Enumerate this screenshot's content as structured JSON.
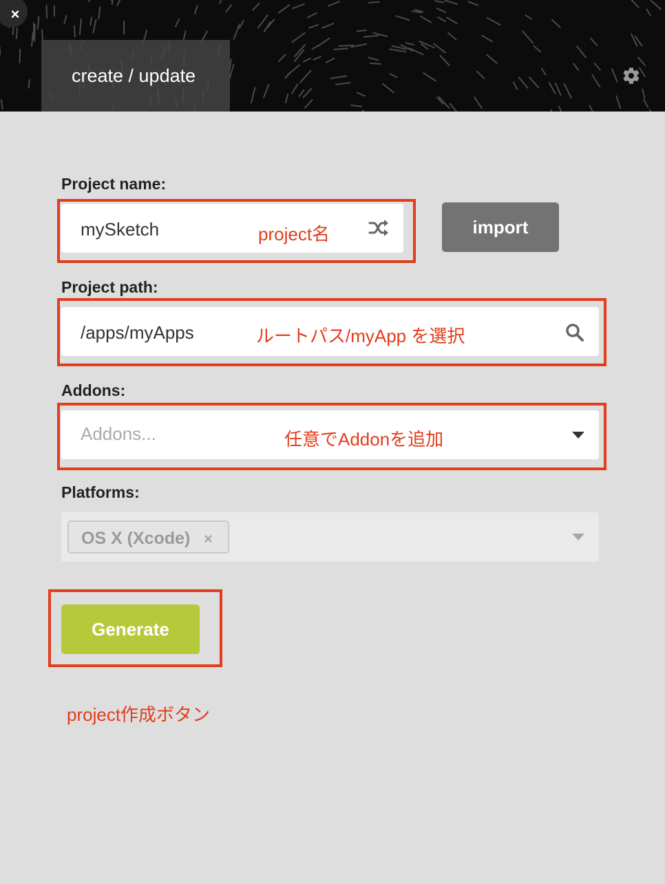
{
  "header": {
    "tab_label": "create / update",
    "close_icon": "×",
    "settings_icon": "gear-icon"
  },
  "form": {
    "project_name": {
      "label": "Project name:",
      "value": "mySketch",
      "action_icon": "shuffle-icon",
      "annotation": "project名"
    },
    "import_label": "import",
    "project_path": {
      "label": "Project path:",
      "value": "/apps/myApps",
      "action_icon": "search-icon",
      "annotation": "ルートパス/myApp を選択"
    },
    "addons": {
      "label": "Addons:",
      "placeholder": "Addons...",
      "annotation": "任意でAddonを追加"
    },
    "platforms": {
      "label": "Platforms:",
      "selected": [
        {
          "label": "OS X (Xcode)",
          "remove_icon": "×"
        }
      ]
    },
    "generate_label": "Generate",
    "generate_annotation": "project作成ボタン"
  },
  "colors": {
    "annotation_red": "#e23d1c",
    "generate_green": "#b5c93b",
    "import_gray": "#737373",
    "background": "#dedede",
    "header_dark": "#0c0c0c"
  }
}
